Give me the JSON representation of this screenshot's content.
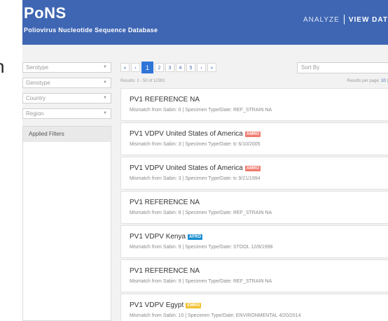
{
  "app": {
    "logo": "PoNS",
    "subtitle": "Poliovirus Nucleotide Sequence Database",
    "nav": {
      "analyze": "ANALYZE",
      "view": "VIEW DAT"
    },
    "edge_letter": "n"
  },
  "filters": {
    "selects": [
      {
        "label": "Serotype"
      },
      {
        "label": "Genotype"
      },
      {
        "label": "Country"
      },
      {
        "label": "Region"
      }
    ],
    "applied_label": "Applied Filters"
  },
  "pagination": {
    "first": "«",
    "prev": "‹",
    "pages": [
      "1",
      "2",
      "3",
      "4",
      "5"
    ],
    "active_page": "1",
    "next": "›",
    "last": "»"
  },
  "sort": {
    "placeholder": "Sort By"
  },
  "results": {
    "count_text": "Results: 1 - 50 of 12391",
    "per_page_label": "Results per page:",
    "per_page_value": "10",
    "per_page_sep": "|"
  },
  "colors": {
    "header": "#3f66b3",
    "AMRO": "#f07a6e",
    "AFRO": "#1a8fd0",
    "EMRO": "#f2c12e",
    "page_active": "#2f74d8"
  },
  "items": [
    {
      "title": "PV1 REFERENCE NA",
      "badge": "",
      "meta": "Mismatch from Sabin: 0 | Specimen Type/Date: REF_STRAIN NA"
    },
    {
      "title": "PV1 VDPV United States of America",
      "badge": "AMRO",
      "meta": "Mismatch from Sabin: 3 | Specimen Type/Date: tc 6/10/2005"
    },
    {
      "title": "PV1 VDPV United States of America",
      "badge": "AMRO",
      "meta": "Mismatch from Sabin: 3 | Specimen Type/Date: tc 9/21/1994"
    },
    {
      "title": "PV1 REFERENCE NA",
      "badge": "",
      "meta": "Mismatch from Sabin: 8 | Specimen Type/Date: REF_STRAIN NA"
    },
    {
      "title": "PV1 VDPV Kenya",
      "badge": "AFRO",
      "meta": "Mismatch from Sabin: 9 | Specimen Type/Date: STOOL 12/8/1998"
    },
    {
      "title": "PV1 REFERENCE NA",
      "badge": "",
      "meta": "Mismatch from Sabin: 9 | Specimen Type/Date: REF_STRAIN NA"
    },
    {
      "title": "PV1 VDPV Egypt",
      "badge": "EMRO",
      "meta": "Mismatch from Sabin: 10 | Specimen Type/Date: ENVIRONMENTAL 4/20/2014"
    }
  ]
}
